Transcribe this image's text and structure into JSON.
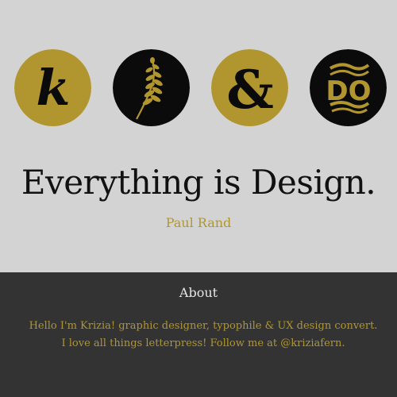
{
  "colors": {
    "background_top": "#d3d3d3",
    "background_bottom": "#333333",
    "gold": "#b1962f",
    "black": "#0b0b0b"
  },
  "logos": [
    {
      "icon": "k-letter-icon",
      "background": "gold",
      "glyph": "k"
    },
    {
      "icon": "fern-icon",
      "background": "black"
    },
    {
      "icon": "ampersand-icon",
      "background": "gold",
      "glyph": "&"
    },
    {
      "icon": "do-lettering-icon",
      "background": "black",
      "glyph": "DO"
    }
  ],
  "hero": {
    "quote": "Everything is Design.",
    "author": "Paul Rand"
  },
  "about": {
    "title": "About",
    "body": "Hello I'm Krizia! graphic designer, typophile & UX design convert. I love all things letterpress! Follow me at @kriziafern."
  }
}
